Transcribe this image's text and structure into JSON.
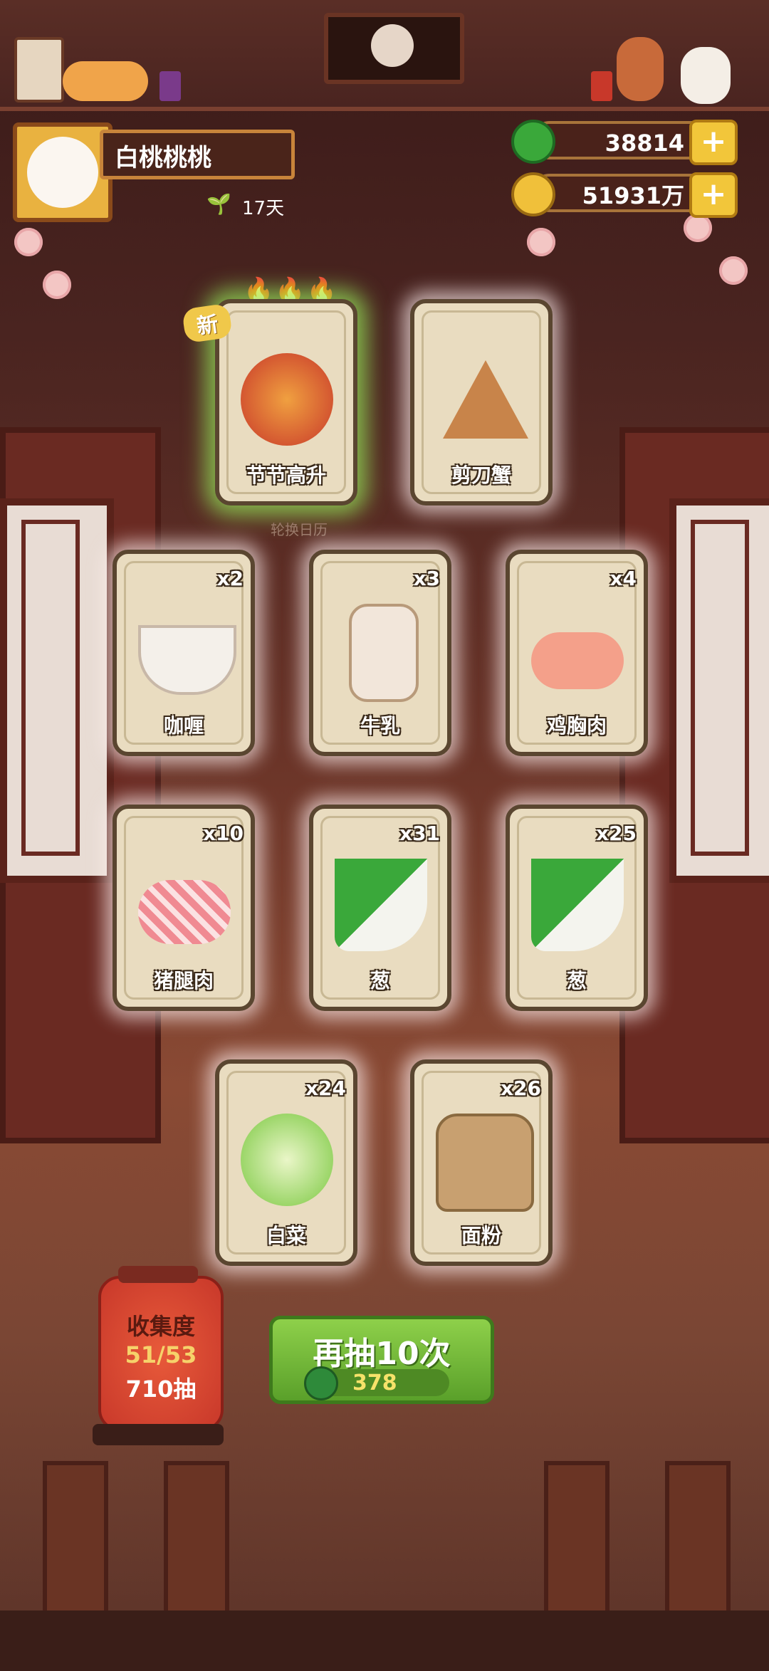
{
  "profile": {
    "name": "白桃桃桃",
    "days": "17天"
  },
  "currency": {
    "jade": "38814",
    "coins": "51931万",
    "plus_label": "+"
  },
  "featured_cards": [
    {
      "name": "节节高升",
      "is_new": true
    },
    {
      "name": "剪刀蟹",
      "is_new": false
    }
  ],
  "new_tag": "新",
  "calendar_label": "轮换日历",
  "cards": [
    {
      "name": "咖喱",
      "count": "x2"
    },
    {
      "name": "牛乳",
      "count": "x3"
    },
    {
      "name": "鸡胸肉",
      "count": "x4"
    },
    {
      "name": "猪腿肉",
      "count": "x10"
    },
    {
      "name": "葱",
      "count": "x31"
    },
    {
      "name": "葱",
      "count": "x25"
    },
    {
      "name": "白菜",
      "count": "x24"
    },
    {
      "name": "面粉",
      "count": "x26"
    }
  ],
  "collection": {
    "title": "收集度",
    "progress": "51/53",
    "draws": "710抽"
  },
  "draw_button": {
    "label": "再抽10次",
    "cost": "378"
  },
  "colors": {
    "accent_green": "#6cbf3a",
    "gold": "#f2c63a",
    "lantern_red": "#d8432e"
  }
}
